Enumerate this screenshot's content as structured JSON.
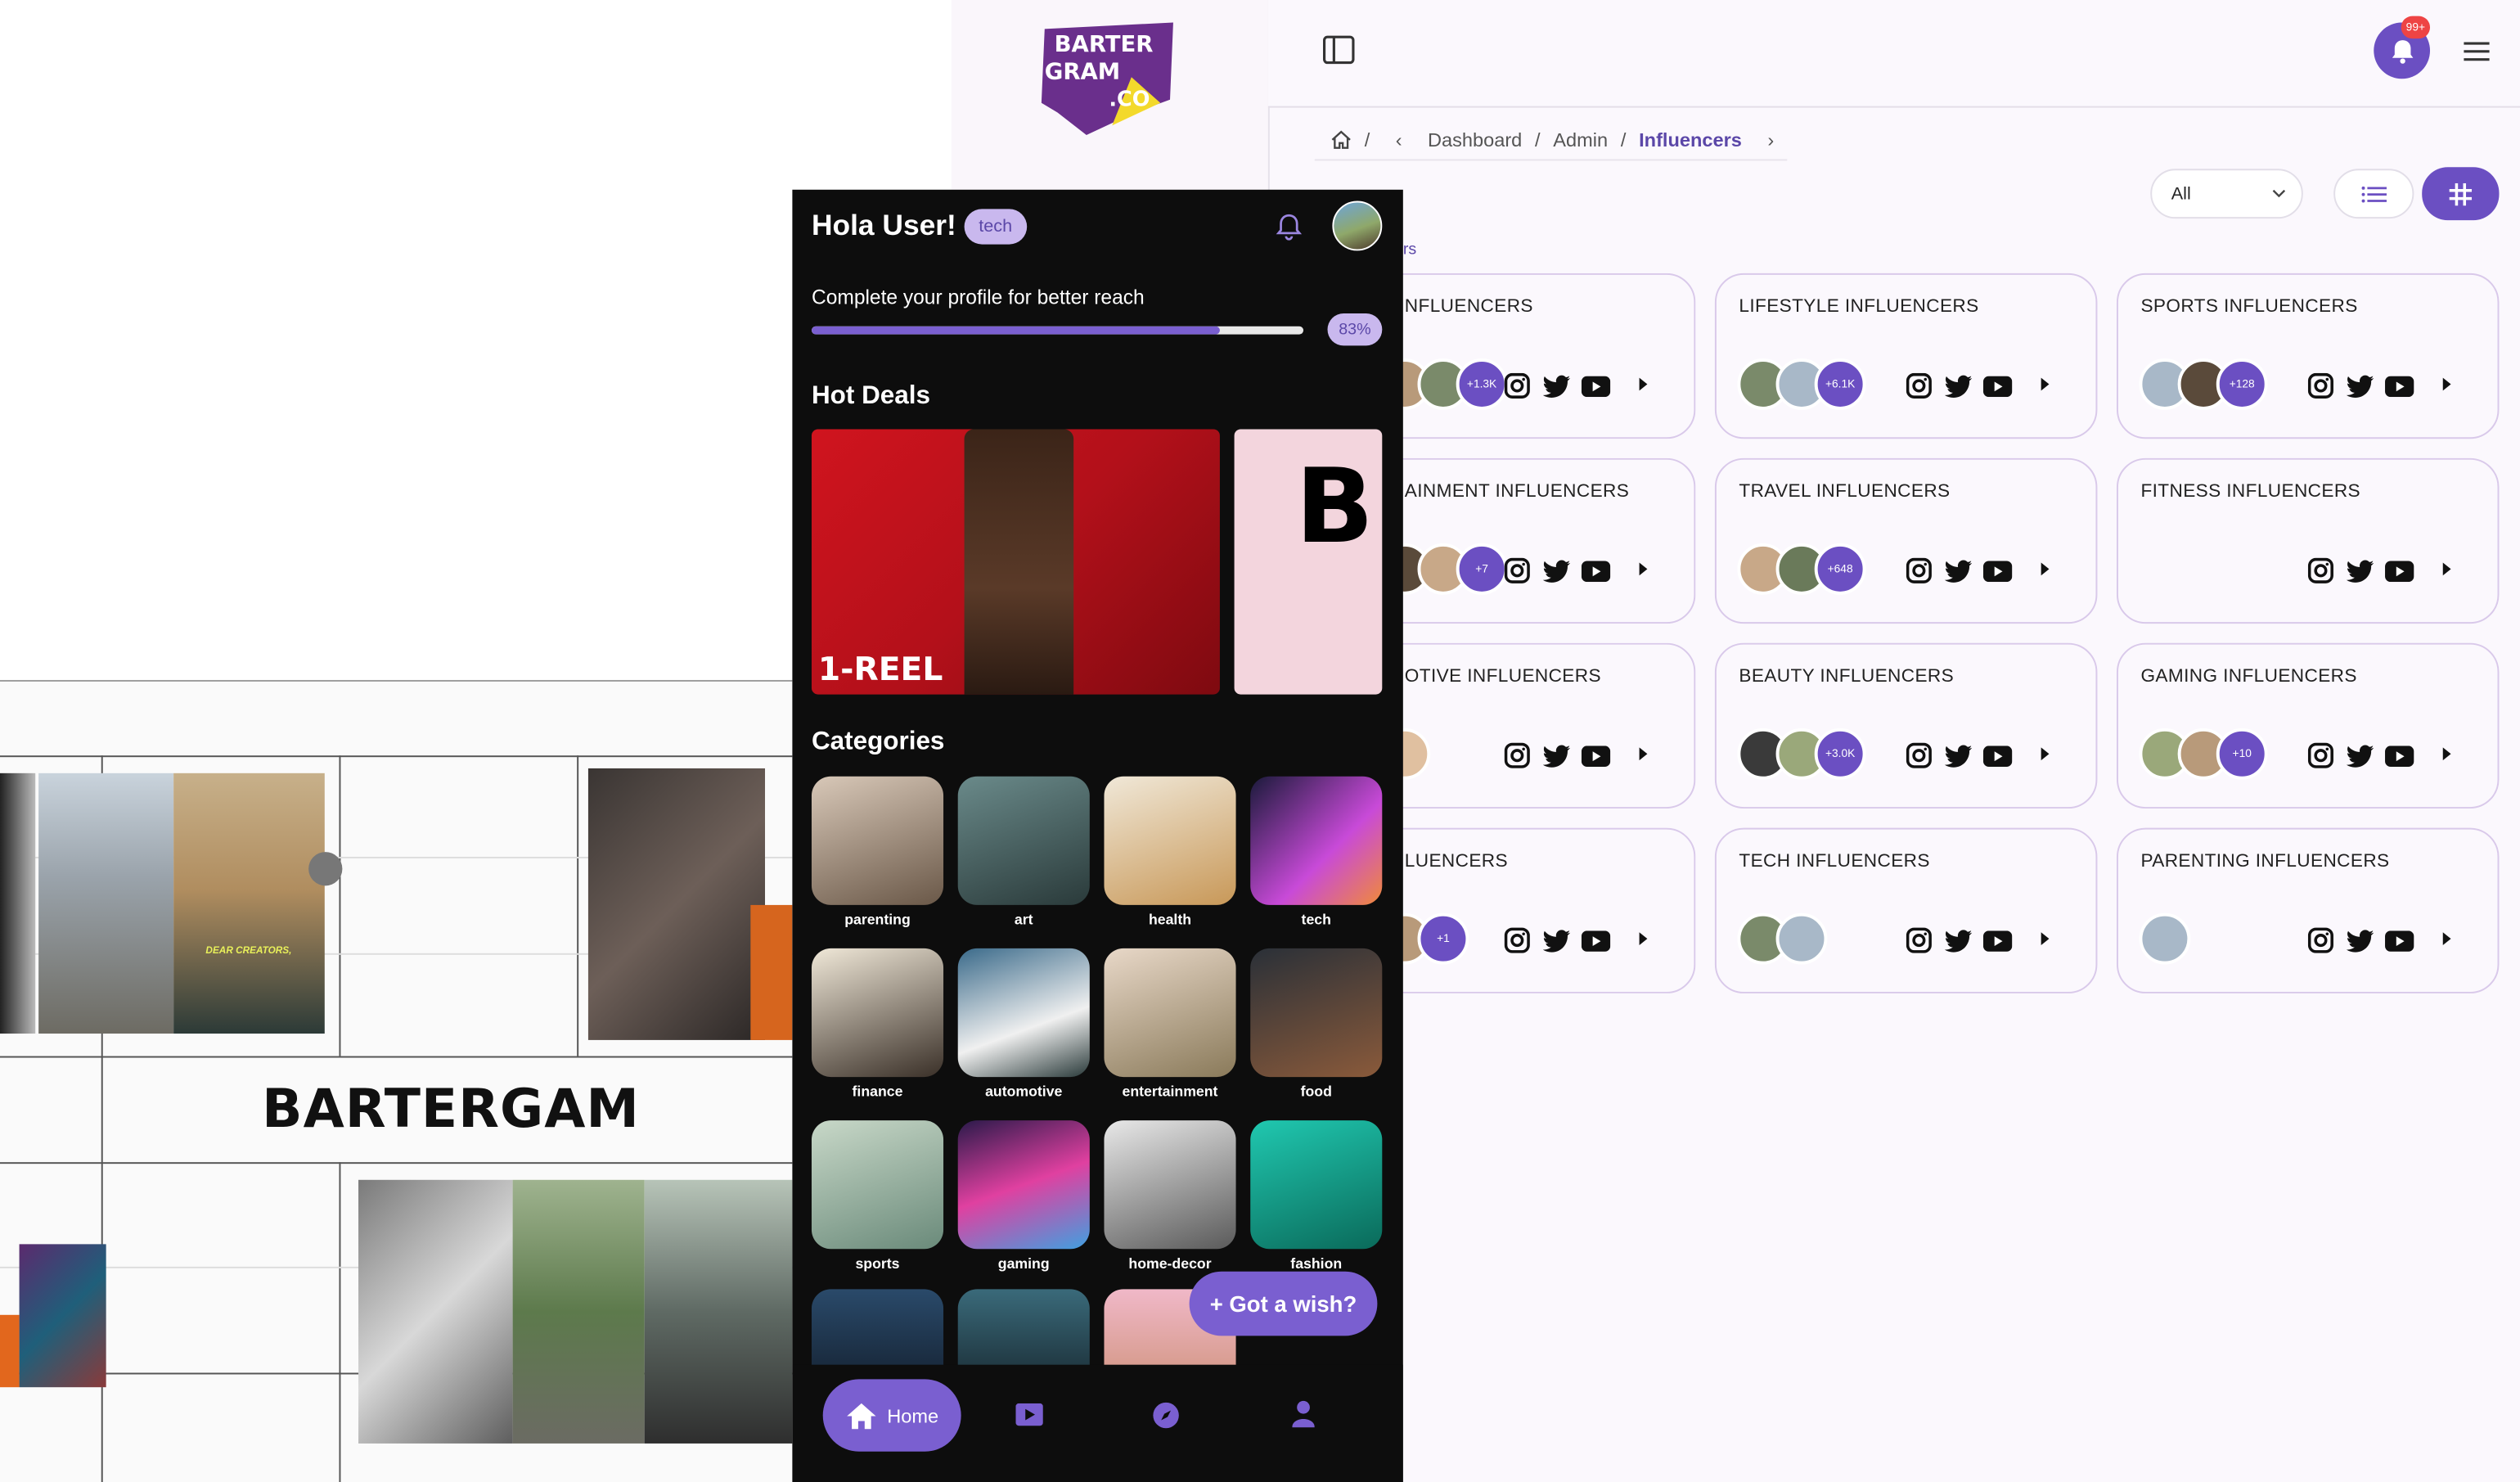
{
  "logo": {
    "line1": "BARTER",
    "line2": "GRAM",
    "line3": ".CO"
  },
  "collage": {
    "brand_word": "BARTERGAM",
    "overlay_text": "DEAR CREATORS,"
  },
  "admin": {
    "notification_badge": "99+",
    "breadcrumb": {
      "items": [
        "Dashboard",
        "Admin"
      ],
      "active": "Influencers",
      "separator": "/"
    },
    "filter": {
      "selected": "All"
    },
    "heading_fragment": "rs",
    "cards": [
      {
        "title": "NFLUENCERS",
        "more": "+1.3K"
      },
      {
        "title": "LIFESTYLE INFLUENCERS",
        "more": "+6.1K"
      },
      {
        "title": "SPORTS INFLUENCERS",
        "more": "+128"
      },
      {
        "title": "AINMENT INFLUENCERS",
        "more": "+7"
      },
      {
        "title": "TRAVEL INFLUENCERS",
        "more": "+648"
      },
      {
        "title": "FITNESS INFLUENCERS",
        "more": ""
      },
      {
        "title": "OTIVE INFLUENCERS",
        "more": ""
      },
      {
        "title": "BEAUTY INFLUENCERS",
        "more": "+3.0K"
      },
      {
        "title": "GAMING INFLUENCERS",
        "more": "+10"
      },
      {
        "title": "LUENCERS",
        "more": "+1"
      },
      {
        "title": "TECH INFLUENCERS",
        "more": ""
      },
      {
        "title": "PARENTING INFLUENCERS",
        "more": ""
      }
    ],
    "colors": {
      "accent": "#6b4fc2",
      "card_border": "#d9c9ea"
    }
  },
  "mobile": {
    "greeting": "Hola User!",
    "tag": "tech",
    "complete_profile": "Complete your profile for better reach",
    "progress_percent": 83,
    "progress_label": "83%",
    "hot_deals_title": "Hot Deals",
    "deal1_label": "1-REEL",
    "deal2_letter": "B",
    "categories_title": "Categories",
    "categories": [
      "parenting",
      "art",
      "health",
      "tech",
      "finance",
      "automotive",
      "entertainment",
      "food",
      "sports",
      "gaming",
      "home-decor",
      "fashion"
    ],
    "wish_button": "+ Got a wish?",
    "nav_home": "Home"
  }
}
